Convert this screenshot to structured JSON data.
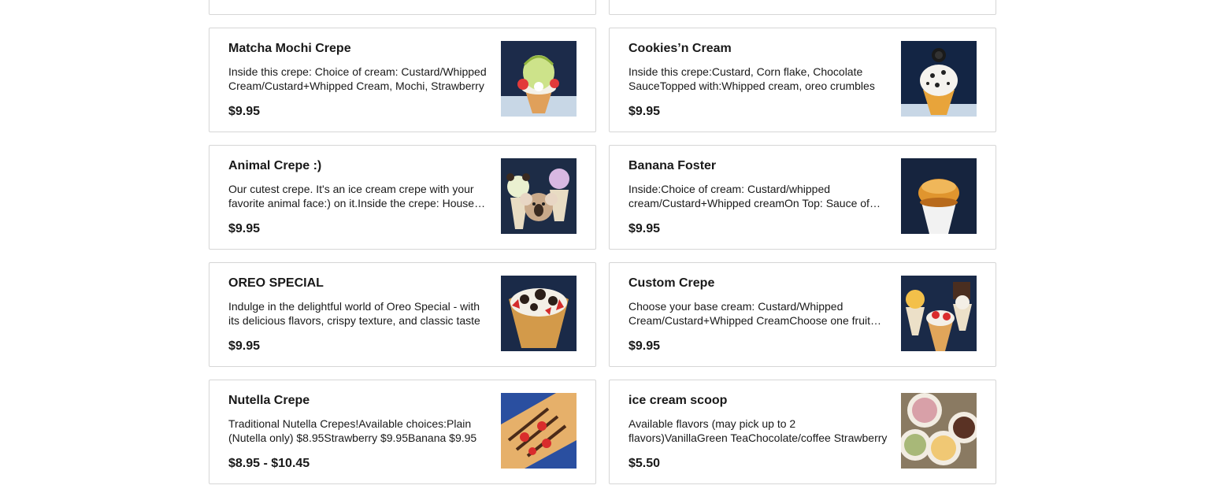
{
  "items": [
    {
      "title": "Matcha Mochi Crepe",
      "desc": "Inside this crepe: Choice of cream: Custard/Whipped Cream/Custard+Whipped Cream, Mochi, Strawberry",
      "price": "$9.95",
      "image_icon": "matcha-crepe-photo"
    },
    {
      "title": "Cookies’n Cream",
      "desc": "Inside this crepe:Custard, Corn flake, Chocolate SauceTopped with:Whipped cream, oreo crumbles",
      "price": "$9.95",
      "image_icon": "cookies-cream-crepe-photo"
    },
    {
      "title": "Animal Crepe :)",
      "desc": "Our cutest crepe. It's an ice cream crepe with your favorite animal face:) on it.Inside the crepe: House made cream",
      "price": "$9.95",
      "image_icon": "animal-crepe-photo"
    },
    {
      "title": "Banana Foster",
      "desc": "Inside:Choice of cream: Custard/whipped cream/Custard+Whipped creamOn Top: Sauce of banana foster",
      "price": "$9.95",
      "image_icon": "banana-foster-crepe-photo"
    },
    {
      "title": "OREO SPECIAL",
      "desc": "Indulge in the delightful world of Oreo Special - with its delicious flavors, crispy texture, and classic taste",
      "price": "$9.95",
      "image_icon": "oreo-special-crepe-photo"
    },
    {
      "title": "Custom Crepe",
      "desc": "Choose your base cream: Custard/Whipped Cream/Custard+Whipped CreamChoose one fruit topping",
      "price": "$9.95",
      "image_icon": "custom-crepe-photo"
    },
    {
      "title": "Nutella Crepe",
      "desc": "Traditional Nutella Crepes!Available choices:Plain (Nutella only) $8.95Strawberry $9.95Banana $9.95",
      "price": "$8.95 - $10.45",
      "image_icon": "nutella-crepe-photo"
    },
    {
      "title": "ice cream scoop",
      "desc": "Available flavors (may pick up to 2 flavors)VanillaGreen TeaChocolate/coffee Strawberry",
      "price": "$5.50",
      "image_icon": "ice-cream-scoop-photo"
    }
  ]
}
